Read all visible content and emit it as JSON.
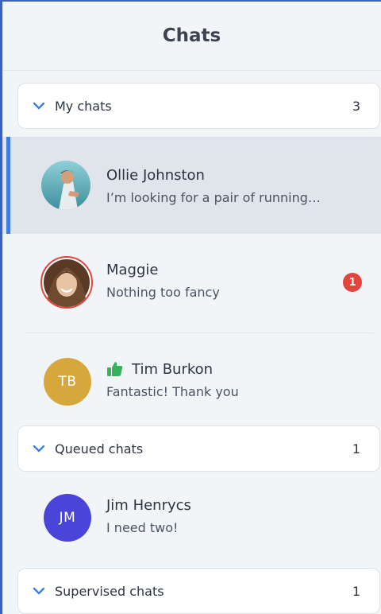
{
  "header": {
    "title": "Chats"
  },
  "sections": {
    "my_chats": {
      "label": "My chats",
      "count": "3"
    },
    "queued": {
      "label": "Queued chats",
      "count": "1"
    },
    "supervised": {
      "label": "Supervised chats",
      "count": "1"
    }
  },
  "chats": [
    {
      "name": "Ollie Johnston",
      "preview": "I’m looking for a pair of running…",
      "avatar": "photo"
    },
    {
      "name": "Maggie",
      "preview": "Nothing too fancy",
      "avatar": "photo",
      "unread": "1"
    },
    {
      "name": "Tim Burkon",
      "preview": "Fantastic! Thank you",
      "initials": "TB",
      "avatar_color": "#d6a83c",
      "status_icon": "thumbs-up-icon"
    },
    {
      "name": "Jim Henrycs",
      "preview": "I need two!",
      "initials": "JM",
      "avatar_color": "#4b44d8"
    }
  ],
  "colors": {
    "accent": "#3f7ee0",
    "chevron": "#3f7ee0",
    "badge": "#e0463e",
    "thumb": "#36b35a"
  }
}
